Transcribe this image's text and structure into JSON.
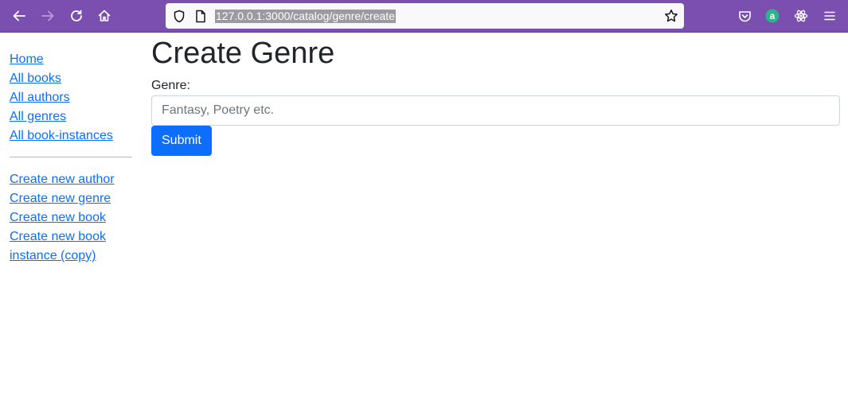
{
  "browser": {
    "url": "127.0.0.1:3000/catalog/genre/create",
    "icons": [
      "back-arrow-icon",
      "forward-arrow-icon",
      "reload-icon",
      "home-icon",
      "shield-icon",
      "page-icon",
      "star-icon",
      "pocket-icon",
      "extension-a-icon",
      "react-icon",
      "menu-icon"
    ],
    "colors": {
      "toolbar": "#7a4fb0",
      "url_highlight": "#9a9aa0",
      "extension_a": "#2db38a"
    }
  },
  "sidebar": {
    "links": [
      "Home",
      "All books",
      "All authors",
      "All genres",
      "All book-instances"
    ],
    "create_links": [
      "Create new author",
      "Create new genre",
      "Create new book",
      "Create new book instance (copy)"
    ]
  },
  "main": {
    "title": "Create Genre",
    "label": "Genre:",
    "input_placeholder": "Fantasy, Poetry etc.",
    "input_value": "",
    "submit_label": "Submit",
    "colors": {
      "link": "#0d6efd",
      "button": "#0d6efd"
    }
  }
}
